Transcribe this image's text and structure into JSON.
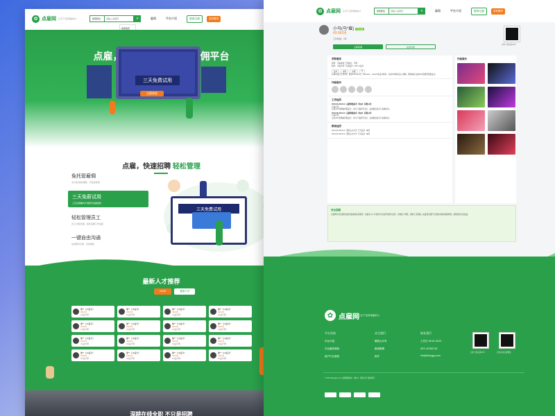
{
  "site": {
    "name": "点雇网",
    "slogan": "让天下没有难雇的人"
  },
  "nav": {
    "search_select": "搜索职位",
    "search_placeholder": "请输入关键词",
    "links": [
      "雇佣",
      "平台介绍"
    ],
    "login": "登录/注册",
    "publish": "发布需求"
  },
  "dropdown": [
    "搜索简历",
    "职位"
  ],
  "hero": {
    "title": "点雇，专业的在线全职雇佣平台",
    "banner": "三天免费试用",
    "cta": "立即体验"
  },
  "section2": {
    "title_a": "点雇，快速招聘",
    "title_b": "轻松管理",
    "card_text": "三天免费试用"
  },
  "features": [
    {
      "title": "免托管雇佣",
      "desc": "支付宝/微信/银联，可直接雇佣"
    },
    {
      "title": "三天免薪试用",
      "desc": "三天试用期内不满意可全额退款"
    },
    {
      "title": "轻松管理员工",
      "desc": "员工日报/周报，随时掌握工作进度"
    },
    {
      "title": "一键自由沟通",
      "desc": "在线即时沟通，高效便捷"
    }
  ],
  "section3": {
    "title": "最新人才推荐",
    "tab_on": "UI/UE",
    "tab_off": "更多人才"
  },
  "talents": [
    {
      "name": "徐**（UI设计）",
      "salary": "¥3K/月",
      "tag": "UI设计师"
    },
    {
      "name": "徐**（UI设计）",
      "salary": "¥3K/月",
      "tag": "UI设计师"
    },
    {
      "name": "徐**（UI设计）",
      "salary": "¥3K/月",
      "tag": "UI设计师"
    },
    {
      "name": "徐**（UI设计）",
      "salary": "¥3K/月",
      "tag": "UI设计师"
    },
    {
      "name": "徐**（UI设计）",
      "salary": "¥3K/月",
      "tag": "UI设计师"
    },
    {
      "name": "徐**（UI设计）",
      "salary": "¥3K/月",
      "tag": "UI设计师"
    },
    {
      "name": "徐**（UI设计）",
      "salary": "¥3K/月",
      "tag": "UI设计师"
    },
    {
      "name": "徐**（UI设计）",
      "salary": "¥3K/月",
      "tag": "UI设计师"
    },
    {
      "name": "徐**（UI设计）",
      "salary": "¥3K/月",
      "tag": "UI设计师"
    },
    {
      "name": "徐**（UI设计）",
      "salary": "¥3K/月",
      "tag": "UI设计师"
    },
    {
      "name": "徐**（UI设计）",
      "salary": "¥3K/月",
      "tag": "UI设计师"
    },
    {
      "name": "徐**（UI设计）",
      "salary": "¥3K/月",
      "tag": "UI设计师"
    },
    {
      "name": "徐**（UI设计）",
      "salary": "¥3K/月",
      "tag": "UI设计师"
    },
    {
      "name": "徐**（UI设计）",
      "salary": "¥3K/月",
      "tag": "UI设计师"
    },
    {
      "name": "徐**（UI设计）",
      "salary": "¥3K/月",
      "tag": "UI设计师"
    },
    {
      "name": "徐**（UI设计）",
      "salary": "¥3K/月",
      "tag": "UI设计师"
    }
  ],
  "footer_slogan": "深耕在线全职 不只是招聘",
  "profile": {
    "name": "小马(马*雇)",
    "badge": "已认证",
    "salary": "¥3.5K/月",
    "meta": "工作经验：3年",
    "btn_hire": "立即雇佣",
    "btn_chat": "在线沟通",
    "qr_caption": "扫码下载点雇APP"
  },
  "resume": {
    "basic_title": "求职意向",
    "basic_lines": [
      "期望：全职雇佣  工作地点：不限",
      "职位：UI设计师 / 平面设计 / APP UI设计"
    ],
    "skills": [
      "设计",
      "交互",
      "平面",
      "UI"
    ],
    "intro": "从事UI设计工作3年，擅长Photoshop、Illustrator、Sketch等设计软件，对用户体验有深入理解，能够独立完成APP及网页界面设计。",
    "portfolio_title": "作品展示",
    "work_title": "工作经历",
    "works": [
      {
        "date": "2016.06-2018.12",
        "company": "点雇网络技术（杭州）有限公司",
        "role": "UI设计师",
        "desc": "负责APP及网站界面设计，参与产品原型讨论，完成视觉设计与切图标注。"
      },
      {
        "date": "2016.06-2018.12",
        "company": "点雇网络技术（杭州）有限公司",
        "role": "UI设计师",
        "desc": "负责APP及网站界面设计，参与产品原型讨论，完成视觉设计与切图标注。"
      }
    ],
    "edu_title": "教育经历",
    "edu": [
      {
        "date": "2014.06-2018.12",
        "school": "亚历山大大学",
        "major": "艺术设计",
        "degree": "本科"
      },
      {
        "date": "2014.06-2018.12",
        "school": "亚历山大大学",
        "major": "艺术设计",
        "degree": "本科"
      }
    ],
    "side_title": "作品展示"
  },
  "notice": {
    "title": "安全提醒",
    "text": "点雇网平台仅提供在线全职雇佣信息服务，请雇主与人才通过平台进行沟通与交易，切勿私下转账，谨防上当受骗。如发现可疑行为请及时联系客服举报，保障您的合法权益。"
  },
  "rfooter": {
    "name": "点雇网",
    "slogan": "让天下没有难雇的人",
    "col1_title": "平台导航",
    "col1": [
      "平台介绍",
      "平台服务规则",
      "用户行为准则"
    ],
    "col2_title": "关注我们",
    "col2": [
      "微信公众号",
      "新浪微博",
      "知乎"
    ],
    "col3_title": "联系我们",
    "col3": [
      "工作日 09:00-18:00",
      "0571-87551762",
      "info@dianggu.com"
    ],
    "qr1": "扫码下载点雇APP",
    "qr2": "扫码关注点雇微信",
    "copyright": "© 2020 dianggu.com 点雇网络技术（杭州）有限公司 版权所有"
  },
  "colors": {
    "brand": "#2aa04a",
    "accent": "#f37b1d"
  }
}
